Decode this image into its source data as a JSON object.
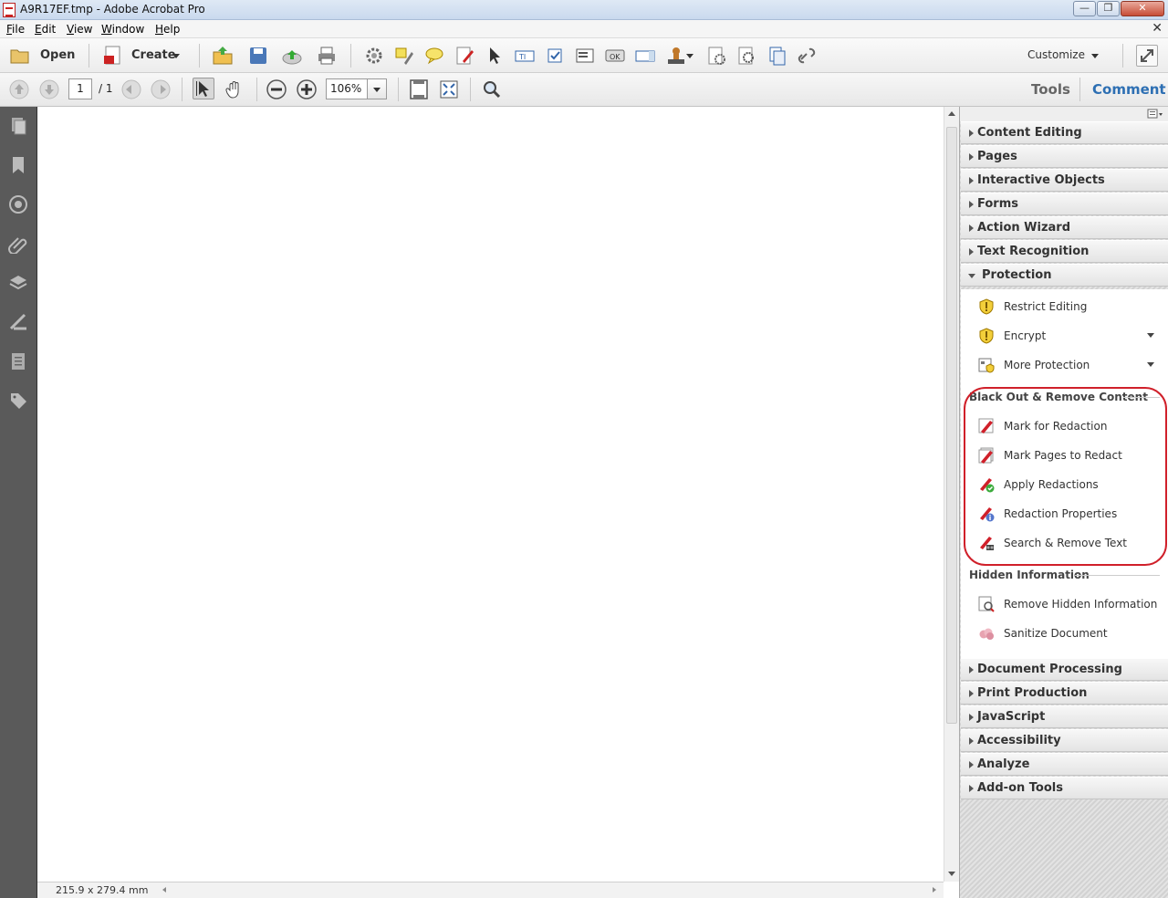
{
  "window": {
    "title": "A9R17EF.tmp - Adobe Acrobat Pro",
    "close_glyph": "✕",
    "min_glyph": "—",
    "max_glyph": "❐"
  },
  "menubar": {
    "items": [
      "File",
      "Edit",
      "View",
      "Window",
      "Help"
    ],
    "close_glyph": "✕"
  },
  "toolbar": {
    "open_label": "Open",
    "create_label": "Create",
    "customize_label": "Customize"
  },
  "nav": {
    "page_value": "1",
    "page_total": "/ 1",
    "zoom_value": "106%",
    "tools_label": "Tools",
    "comment_label": "Comment"
  },
  "status": {
    "page_dims": "215.9 x 279.4 mm"
  },
  "tools_panel": {
    "sections_top": [
      "Content Editing",
      "Pages",
      "Interactive Objects",
      "Forms",
      "Action Wizard",
      "Text Recognition"
    ],
    "protection": {
      "title": "Protection",
      "items": [
        "Restrict Editing",
        "Encrypt",
        "More Protection"
      ],
      "blackout_header": "Black Out & Remove Content",
      "blackout_items": [
        "Mark for Redaction",
        "Mark Pages to Redact",
        "Apply Redactions",
        "Redaction Properties",
        "Search & Remove Text"
      ],
      "hidden_header": "Hidden Information",
      "hidden_items": [
        "Remove Hidden Information",
        "Sanitize Document"
      ]
    },
    "sections_bottom": [
      "Document Processing",
      "Print Production",
      "JavaScript",
      "Accessibility",
      "Analyze",
      "Add-on Tools"
    ]
  }
}
